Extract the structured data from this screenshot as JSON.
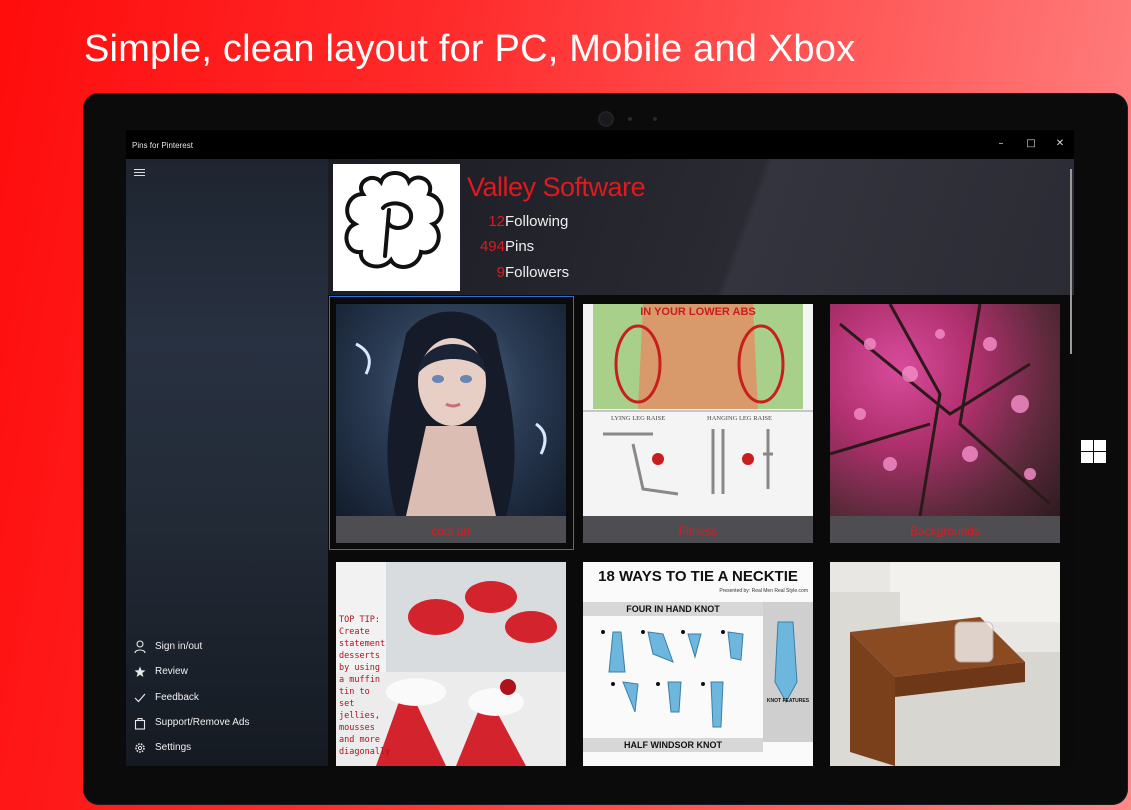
{
  "headline": "Simple, clean layout for PC, Mobile and Xbox",
  "window": {
    "title": "Pins for Pinterest",
    "minimize": "–",
    "maximize": "□",
    "close": "✕"
  },
  "profile": {
    "name": "Valley Software",
    "stats": [
      {
        "value": "12",
        "label": "Following"
      },
      {
        "value": "494",
        "label": "Pins"
      },
      {
        "value": "9",
        "label": "Followers"
      }
    ]
  },
  "boards": [
    {
      "name": "cool art"
    },
    {
      "name": "Fitness"
    },
    {
      "name": "Backgrounds"
    }
  ],
  "pins": {
    "tie_title": "18 WAYS TO TIE A NECKTIE",
    "tie_subtitle": "Presented by: Real Men Real Style.com",
    "knot1": "FOUR IN HAND KNOT",
    "knot2": "HALF WINDSOR KNOT",
    "knot_features": "KNOT FEATURES",
    "abs_title": "IN YOUR LOWER ABS",
    "abs_left": "LYING LEG RAISE",
    "abs_right": "HANGING LEG RAISE",
    "tip_text": "TOP TIP: Create statement desserts by using a muffin tin to set jellies, mousses and more diagonally"
  },
  "menu": [
    {
      "icon": "person-icon",
      "label": "Sign in/out"
    },
    {
      "icon": "star-icon",
      "label": "Review"
    },
    {
      "icon": "check-icon",
      "label": "Feedback"
    },
    {
      "icon": "bag-icon",
      "label": "Support/Remove Ads"
    },
    {
      "icon": "gear-icon",
      "label": "Settings"
    }
  ],
  "colors": {
    "accent": "#e0191f",
    "selection": "#2d6fd6"
  }
}
